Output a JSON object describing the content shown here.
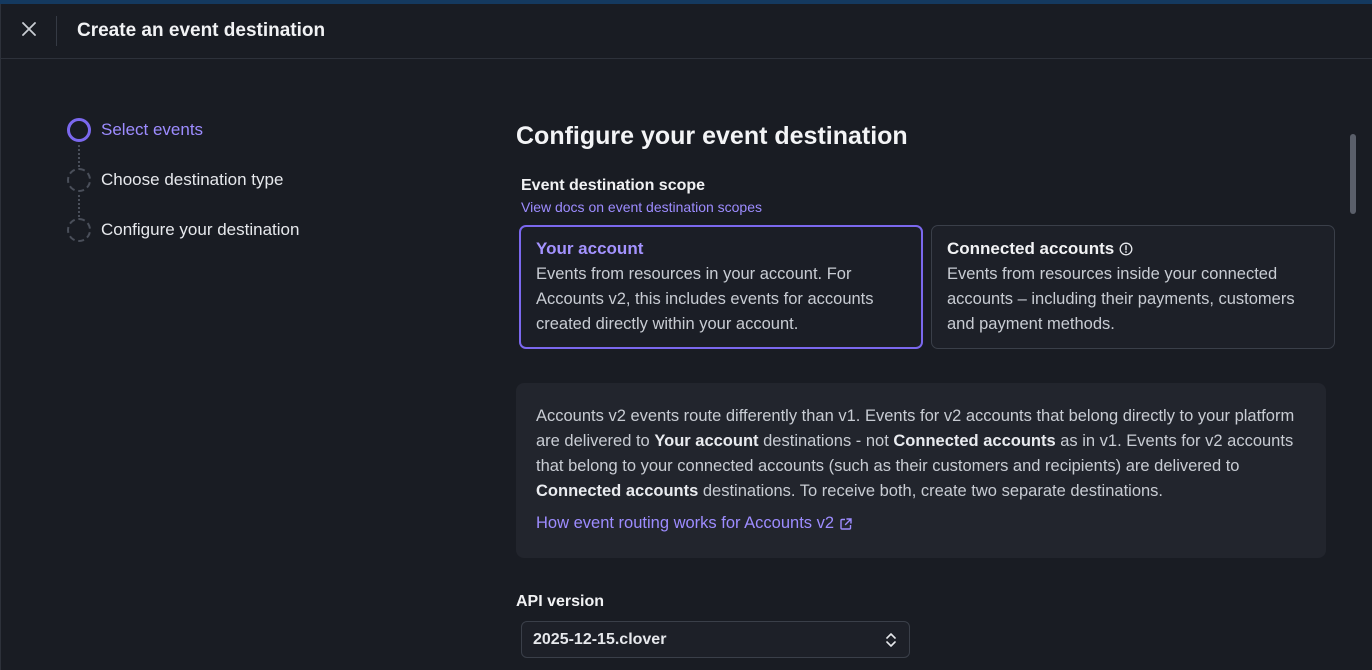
{
  "header": {
    "title": "Create an event destination"
  },
  "icons": {
    "close": "close-icon",
    "info": "info-icon",
    "external": "external-link-icon",
    "select": "chevron-up-down-icon"
  },
  "stepper": {
    "steps": [
      {
        "label": "Select events",
        "active": true
      },
      {
        "label": "Choose destination type",
        "active": false
      },
      {
        "label": "Configure your destination",
        "active": false
      }
    ]
  },
  "main": {
    "title": "Configure your event destination",
    "scope_label": "Event destination scope",
    "docs_link": "View docs on event destination scopes",
    "cards": [
      {
        "title": "Your account",
        "description": "Events from resources in your account. For Accounts v2, this includes events for accounts created directly within your account.",
        "selected": true
      },
      {
        "title": "Connected accounts",
        "description": "Events from resources inside your connected accounts – including their payments, customers and payment methods.",
        "selected": false
      }
    ],
    "notice": {
      "p1": "Accounts v2 events route differently than v1. Events for v2 accounts that belong directly to your platform are delivered to ",
      "b1": "Your account",
      "p2": " destinations - not ",
      "b2": "Connected accounts",
      "p3": " as in v1. Events for v2 accounts that belong to your connected accounts (such as their customers and recipients) are delivered to ",
      "b3": "Connected accounts",
      "p4": " destinations. To receive both, create two separate destinations.",
      "link": "How event routing works for Accounts v2"
    },
    "api_version_label": "API version",
    "api_version_value": "2025-12-15.clover"
  },
  "colors": {
    "accent": "#7b68ee",
    "accent_text": "#9d8cff",
    "background": "#191c23"
  }
}
